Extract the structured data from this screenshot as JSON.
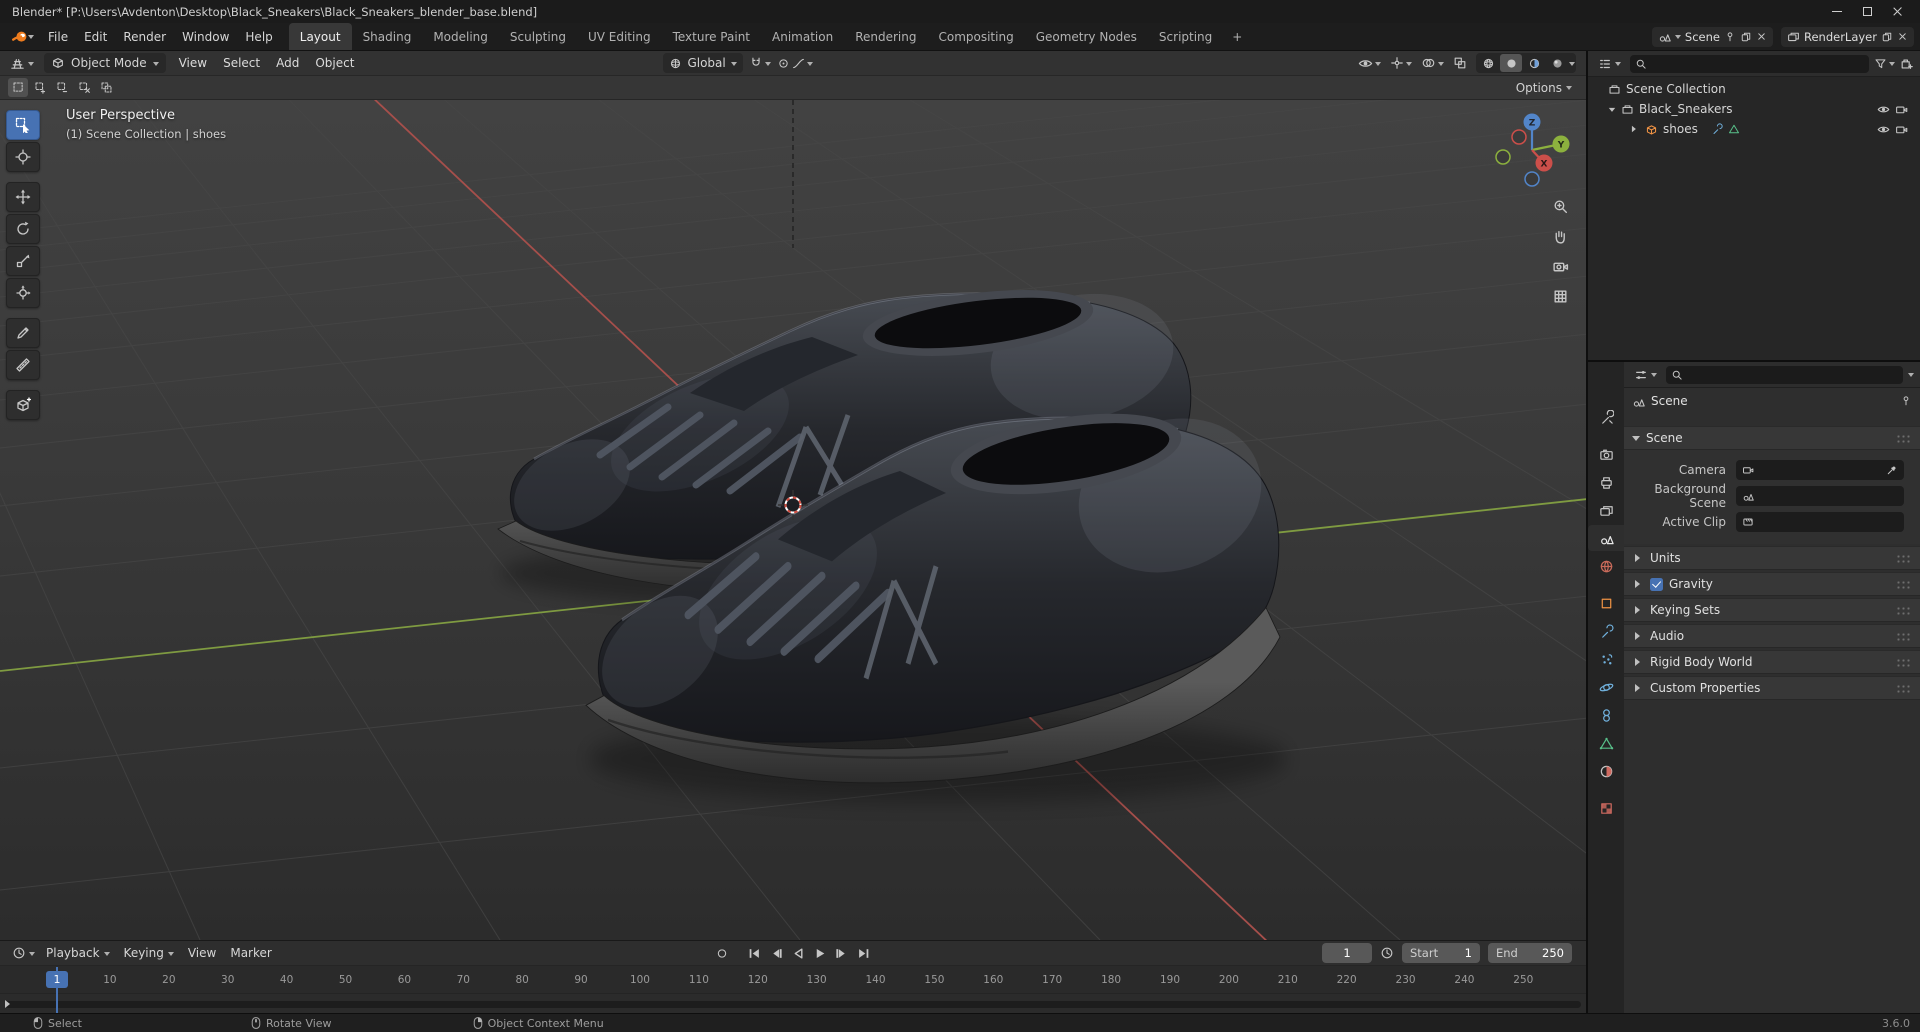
{
  "colors": {
    "accent": "#4772b3",
    "axis_x": "#a64f4b",
    "axis_y": "#8fae3e",
    "axis_z": "#5285c9",
    "active_tool": "#4772b3"
  },
  "title_bar": {
    "title": "Blender* [P:\\Users\\Avdenton\\Desktop\\Black_Sneakers\\Black_Sneakers_blender_base.blend]"
  },
  "top_bar": {
    "menus": [
      "File",
      "Edit",
      "Render",
      "Window",
      "Help"
    ],
    "workspaces": [
      "Layout",
      "Shading",
      "Modeling",
      "Sculpting",
      "UV Editing",
      "Texture Paint",
      "Animation",
      "Rendering",
      "Compositing",
      "Geometry Nodes",
      "Scripting"
    ],
    "active_workspace": "Layout",
    "add_workspace_label": "+",
    "scene_selector": {
      "value": "Scene"
    },
    "view_layer_selector": {
      "value": "RenderLayer"
    }
  },
  "viewport": {
    "header": {
      "mode": "Object Mode",
      "menus": [
        "View",
        "Select",
        "Add",
        "Object"
      ],
      "orientation": "Global",
      "options_label": "Options"
    },
    "overlay": {
      "view_label": "User Perspective",
      "context_label": "(1) Scene Collection | shoes"
    },
    "axis_gizmo": {
      "x_label": "X",
      "y_label": "Y",
      "z_label": "Z"
    },
    "tools": [
      "select-box",
      "cursor",
      "move",
      "rotate",
      "scale",
      "transform",
      "annotate",
      "measure",
      "add-cube"
    ],
    "active_tool": "select-box",
    "side_buttons": [
      "zoom",
      "pan",
      "camera-view",
      "toggle-ortho"
    ]
  },
  "outliner": {
    "rows": [
      {
        "label": "Scene Collection",
        "icon": "collection-icon"
      },
      {
        "label": "Black_Sneakers",
        "icon": "collection-icon"
      },
      {
        "label": "shoes",
        "icon": "mesh-object-icon"
      }
    ]
  },
  "properties": {
    "tabs": [
      "tool",
      "render",
      "output",
      "view-layer",
      "scene",
      "world",
      "object",
      "modifiers",
      "particles",
      "physics",
      "constraints",
      "object-data",
      "material",
      "texture"
    ],
    "active_tab": "scene",
    "breadcrumb": "Scene",
    "scene_section": {
      "title": "Scene",
      "fields": [
        {
          "label": "Camera",
          "icon": "camera-icon"
        },
        {
          "label": "Background Scene",
          "icon": "scene-icon"
        },
        {
          "label": "Active Clip",
          "icon": "clip-icon"
        }
      ]
    },
    "collapsed_sections": [
      {
        "label": "Units"
      },
      {
        "label": "Gravity",
        "checkbox": true,
        "checked": true
      },
      {
        "label": "Keying Sets"
      },
      {
        "label": "Audio"
      },
      {
        "label": "Rigid Body World"
      },
      {
        "label": "Custom Properties"
      }
    ]
  },
  "timeline": {
    "menus": [
      "Playback",
      "Keying",
      "View",
      "Marker"
    ],
    "current_frame": "1",
    "playhead_label": "1",
    "start_label": "Start",
    "start_value": "1",
    "end_label": "End",
    "end_value": "250",
    "ticks": [
      "10",
      "20",
      "30",
      "40",
      "50",
      "60",
      "70",
      "80",
      "90",
      "100",
      "110",
      "120",
      "130",
      "140",
      "150",
      "160",
      "170",
      "180",
      "190",
      "200",
      "210",
      "220",
      "230",
      "240",
      "250"
    ]
  },
  "status_bar": {
    "hints": [
      {
        "label": "Select",
        "icon": "left-mouse-icon"
      },
      {
        "label": "Rotate View",
        "icon": "middle-mouse-icon"
      },
      {
        "label": "Object Context Menu",
        "icon": "right-mouse-icon"
      }
    ],
    "version": "3.6.0"
  }
}
